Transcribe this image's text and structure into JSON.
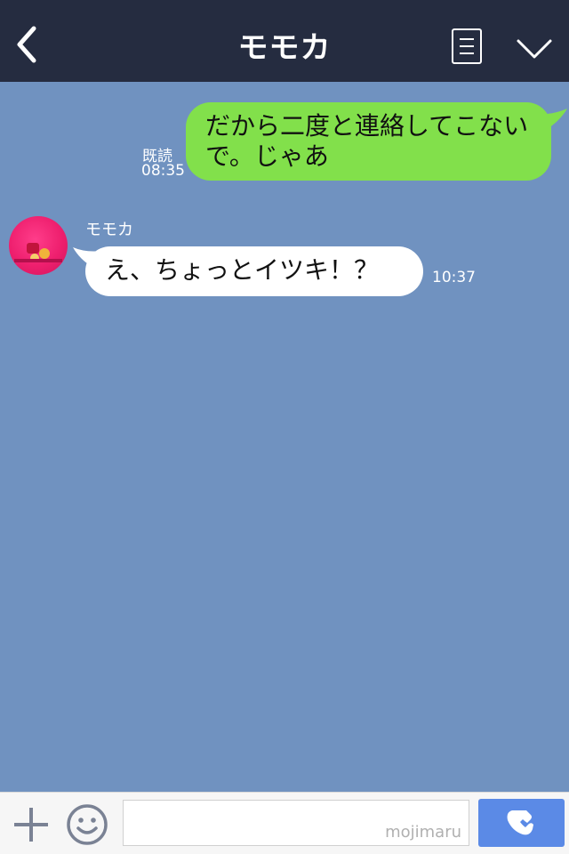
{
  "header": {
    "title": "モモカ"
  },
  "messages": {
    "sent": {
      "text": "だから二度と連絡してこないで。じゃあ",
      "read_label": "既読",
      "time": "08:35"
    },
    "received": {
      "sender": "モモカ",
      "text": "え、ちょっとイツキ！？",
      "time": "10:37"
    }
  },
  "input": {
    "watermark": "mojimaru"
  },
  "colors": {
    "chat_background": "#7092c0",
    "header_background": "#252c40",
    "sent_bubble": "#82e04b",
    "received_bubble": "#ffffff",
    "call_button": "#5b8ae6"
  },
  "icons": {
    "back": "chevron-left-icon",
    "menu": "document-menu-icon",
    "collapse": "chevron-down-icon",
    "plus": "plus-icon",
    "emoji": "smiley-icon",
    "call": "phone-icon"
  }
}
